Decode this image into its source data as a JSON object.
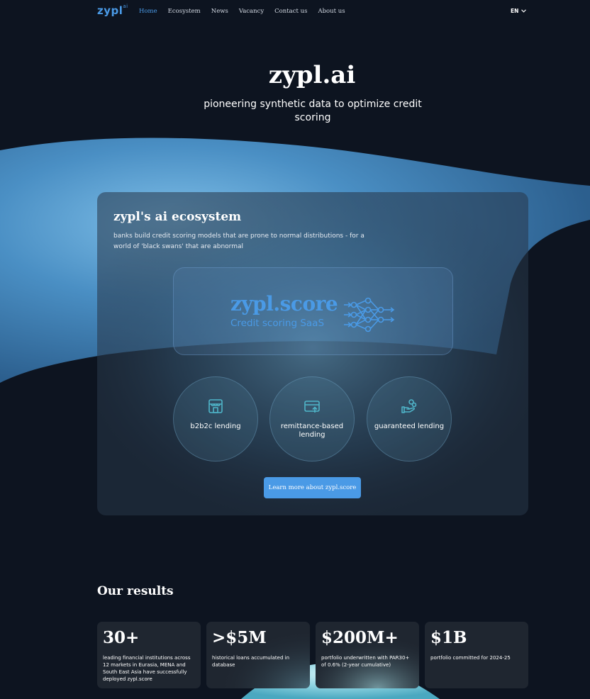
{
  "nav": {
    "logo": "zypl",
    "logo_sup": "ai",
    "links": [
      {
        "label": "Home",
        "active": true
      },
      {
        "label": "Ecosystem"
      },
      {
        "label": "News"
      },
      {
        "label": "Vacancy"
      },
      {
        "label": "Contact us"
      },
      {
        "label": "About us"
      }
    ],
    "language": "EN"
  },
  "hero": {
    "title": "zypl.ai",
    "subtitle": "pioneering synthetic data to optimize credit scoring"
  },
  "ecosystem": {
    "title": "zypl's ai ecosystem",
    "description": "banks build credit scoring models that are prone to normal distributions - for a world of 'black swans' that are abnormal",
    "product_name": "zypl.score",
    "product_tagline": "Credit scoring SaaS",
    "segments": [
      {
        "label": "b2b2c lending",
        "icon": "store-icon"
      },
      {
        "label": "remittance-based lending",
        "icon": "card-transfer-icon"
      },
      {
        "label": "guaranteed lending",
        "icon": "hand-coins-icon"
      }
    ],
    "cta_label": "Learn more about zypl.score"
  },
  "results": {
    "title": "Our results",
    "stats": [
      {
        "value": "30+",
        "description": "leading financial institutions across 12 markets in Eurasia, MENA and South East Asia have successfully deployed zypl.score"
      },
      {
        "value": ">$5M",
        "description": "historical loans accumulated in database"
      },
      {
        "value": "$200M+",
        "description": "portfolio underwritten with PAR30+ of 0.6% (2-year cumulative)"
      },
      {
        "value": "$1B",
        "description": "portfolio committed for 2024-25"
      }
    ]
  },
  "colors": {
    "accent": "#4a9ae6",
    "background": "#0d1420",
    "card": "#1f2630"
  }
}
